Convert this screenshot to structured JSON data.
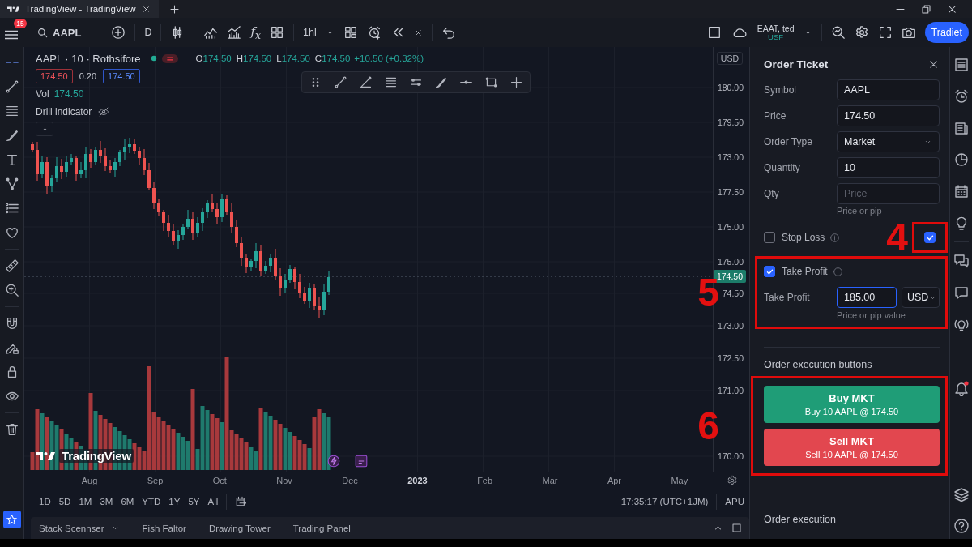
{
  "browser": {
    "tab": {
      "title": "TradingView - TradingView"
    }
  },
  "toolbar": {
    "notification_badge": "15",
    "symbol": "AAPL",
    "interval": "D",
    "formula": "f$_{x}$",
    "timeframe": "1hl",
    "account": {
      "name": "EAAT, ted",
      "currency": "USF"
    },
    "trade_button": "Tradiet"
  },
  "chart": {
    "legend": {
      "title": "AAPL · 10 · Rothsifore",
      "ohlc": [
        {
          "key": "O",
          "value": "174.50"
        },
        {
          "key": "H",
          "value": "174.50"
        },
        {
          "key": "L",
          "value": "174.50"
        },
        {
          "key": "C",
          "value": "174.50"
        }
      ],
      "change": "+10.50 (+0.32%)"
    },
    "quote": {
      "sell": "174.50",
      "spread": "0.20",
      "buy": "174.50"
    },
    "volume": {
      "label": "Vol",
      "value": "174.50"
    },
    "indicator": {
      "name": "Drill indicator"
    },
    "currency": "USD",
    "price_axis": [
      "180.00",
      "179.50",
      "173.00",
      "177.50",
      "175.00",
      "175.00",
      "74.50",
      "173.00",
      "172.50",
      "171.00",
      "170.00"
    ],
    "last_price": "174.50",
    "time_axis": [
      {
        "label": "Aug",
        "kind": "month"
      },
      {
        "label": "Sep",
        "kind": "month"
      },
      {
        "label": "Oct",
        "kind": "month"
      },
      {
        "label": "Nov",
        "kind": "month"
      },
      {
        "label": "Dec",
        "kind": "month"
      },
      {
        "label": "2023",
        "kind": "year"
      },
      {
        "label": "Feb",
        "kind": "month"
      },
      {
        "label": "Mar",
        "kind": "month"
      },
      {
        "label": "Apr",
        "kind": "month"
      },
      {
        "label": "May",
        "kind": "month"
      }
    ],
    "logo_text": "TradingView"
  },
  "range_bar": {
    "ranges": [
      "1D",
      "5D",
      "1M",
      "3M",
      "6M",
      "YTD",
      "1Y",
      "5Y",
      "All"
    ],
    "clock": "17:35:17 (UTC+1JM)",
    "scale": "APU"
  },
  "bottom_tabs": [
    {
      "label": "Stack Scennser",
      "has_menu": true
    },
    {
      "label": "Fish Faltor",
      "has_menu": false
    },
    {
      "label": "Drawing Tower",
      "has_menu": false
    },
    {
      "label": "Trading Panel",
      "has_menu": false
    }
  ],
  "order_ticket": {
    "title": "Order Ticket",
    "fields": [
      {
        "label": "Symbol",
        "kind": "input",
        "value": "AAPL"
      },
      {
        "label": "Price",
        "kind": "input",
        "value": "174.50"
      },
      {
        "label": "Order Type",
        "kind": "select",
        "value": "Market"
      },
      {
        "label": "Quantity",
        "kind": "input",
        "value": "10"
      },
      {
        "label": "Qty",
        "kind": "input",
        "placeholder": "Price",
        "hint": "Price or pip"
      }
    ],
    "stop_loss": {
      "label": "Stop Loss",
      "checked": false
    },
    "side_checkbox": {
      "checked": true,
      "callout": "4"
    },
    "take_profit": {
      "label": "Take Profit",
      "checked": true,
      "callout": "5",
      "field": {
        "label": "Take Profit",
        "value": "185.00",
        "focused": true,
        "unit": "USD",
        "hint": "Price or pip value"
      }
    },
    "execution": {
      "heading": "Order execution buttons",
      "callout": "6",
      "buttons": [
        {
          "kind": "buy",
          "title": "Buy MKT",
          "detail": "Buy 10 AAPL @ 174.50"
        },
        {
          "kind": "sell",
          "title": "Sell MKT",
          "detail": "Sell 10 AAPL @ 174.50"
        }
      ]
    },
    "next_section": "Order execution"
  }
}
